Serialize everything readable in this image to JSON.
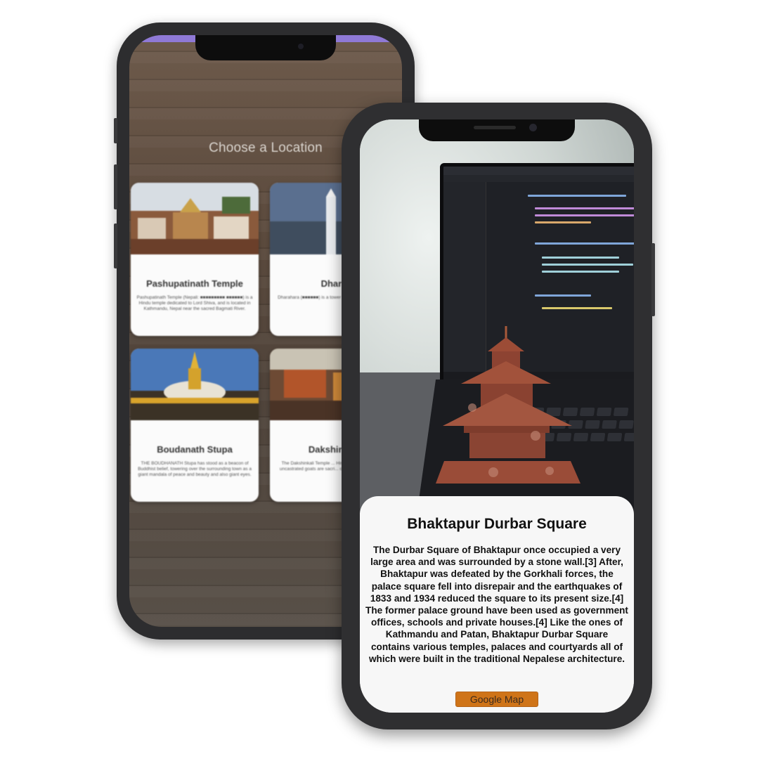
{
  "back_app": {
    "heading": "Choose a Location",
    "cards": [
      {
        "title": "Pashupatinath Temple",
        "description": "Pashupatinath Temple (Nepali: ■■■■■■■■■ ■■■■■■) is a Hindu temple dedicated to Lord Shiva, and is located in Kathmandu, Nepal near the sacred Bagmati River."
      },
      {
        "title": "Dhara",
        "description": "Dharahara (■■■■■■) is a tower at the centre of ... Nepa"
      },
      {
        "title": "Boudanath Stupa",
        "description": "THE BOUDHANATH Stupa has stood as a beacon of Buddhist belief, towering over the surrounding town as a giant mandala of peace and beauty and also giant eyes."
      },
      {
        "title": "Dakshinkali",
        "description": "The Dakshinkali Temple ... Hindus where animals ... uncastrated goats are sacri... of wishes and well bei..."
      }
    ]
  },
  "front_app": {
    "title": "Bhaktapur Durbar Square",
    "description": "The Durbar Square of Bhaktapur once occupied a very large area and was surrounded by a stone wall.[3] After, Bhaktapur was defeated by the Gorkhali forces, the palace square fell into disrepair and the earthquakes of 1833 and 1934 reduced the square to its present size.[4] The former palace ground have been used as government offices, schools and private houses.[4] Like the ones of Kathmandu and Patan, Bhaktapur Durbar Square contains various temples, palaces and courtyards all of which were built in the traditional Nepalese architecture.",
    "map_button": "Google Map"
  }
}
